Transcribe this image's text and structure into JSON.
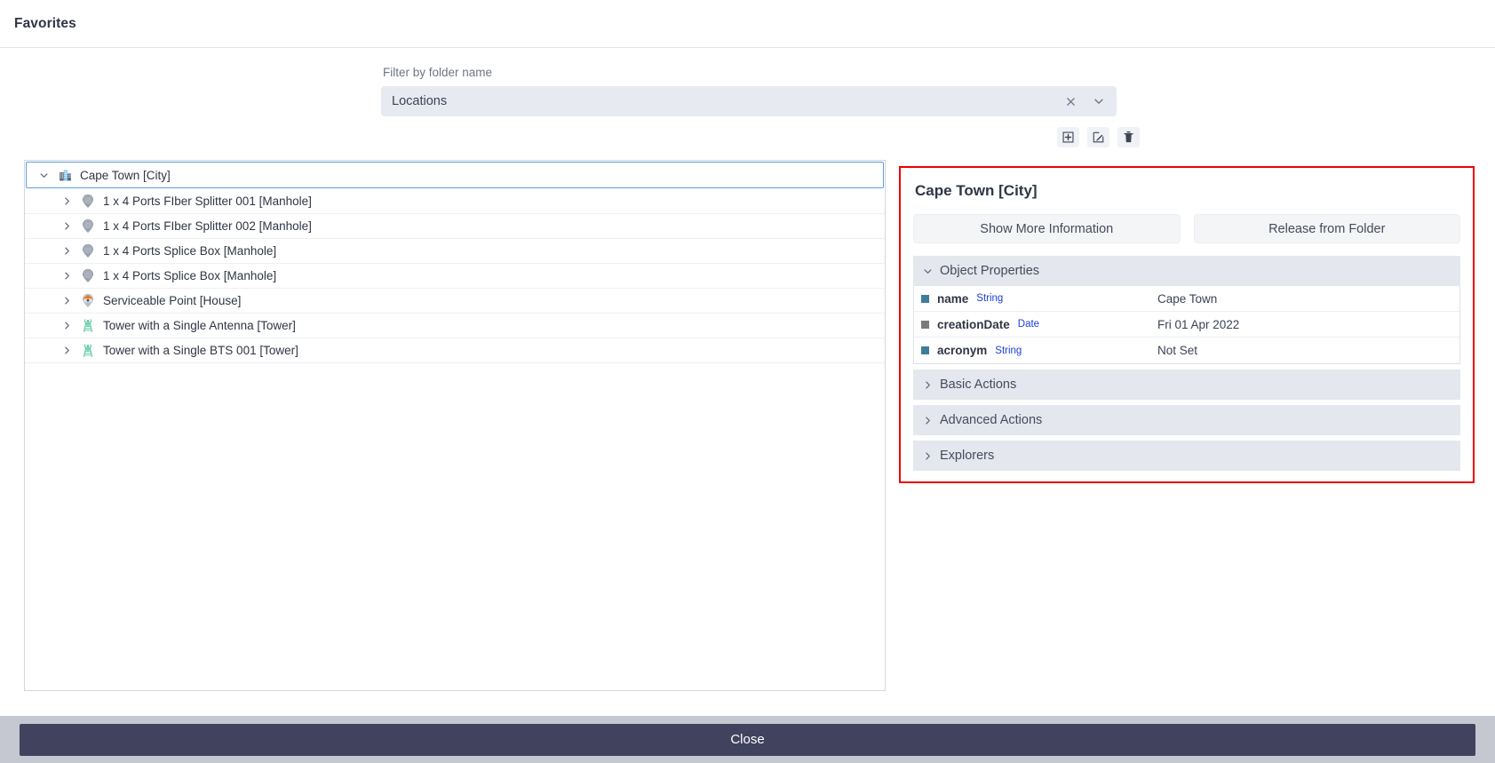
{
  "header": {
    "title": "Favorites"
  },
  "filter": {
    "label": "Filter by folder name",
    "value": "Locations",
    "placeholder": "Filter by folder name",
    "clear_icon": "close-icon",
    "dropdown_icon": "chevron-down-icon"
  },
  "toolbar": {
    "add_label": "Add Folder",
    "edit_label": "Edit Folder",
    "delete_label": "Delete Folder",
    "add_icon": "plus-box-icon",
    "edit_icon": "pencil-square-icon",
    "delete_icon": "trash-icon"
  },
  "tree": {
    "root": {
      "label": "Cape Town [City]",
      "icon": "city-building-icon",
      "expanded": true,
      "selected": true
    },
    "children": [
      {
        "label": "1 x 4 Ports FIber Splitter 001 [Manhole]",
        "icon": "manhole-pin-icon",
        "expanded": false
      },
      {
        "label": "1 x 4 Ports FIber Splitter 002 [Manhole]",
        "icon": "manhole-pin-icon",
        "expanded": false
      },
      {
        "label": "1 x 4 Ports Splice Box [Manhole]",
        "icon": "manhole-pin-icon",
        "expanded": false
      },
      {
        "label": "1 x 4 Ports Splice Box [Manhole]",
        "icon": "manhole-pin-icon",
        "expanded": false
      },
      {
        "label": "Serviceable Point [House]",
        "icon": "house-pin-icon",
        "expanded": false
      },
      {
        "label": "Tower with a Single Antenna [Tower]",
        "icon": "tower-icon",
        "expanded": false
      },
      {
        "label": "Tower with a Single BTS 001 [Tower]",
        "icon": "tower-icon",
        "expanded": false
      }
    ]
  },
  "detail": {
    "title": "Cape Town [City]",
    "buttons": {
      "show_more": "Show More Information",
      "release": "Release from Folder"
    },
    "sections": {
      "object_properties": "Object Properties",
      "basic_actions": "Basic Actions",
      "advanced_actions": "Advanced Actions",
      "explorers": "Explorers"
    },
    "properties": [
      {
        "name": "name",
        "type": "String",
        "value": "Cape Town",
        "swatch": "#3f7d9c"
      },
      {
        "name": "creationDate",
        "type": "Date",
        "value": "Fri 01 Apr 2022",
        "swatch": "#7b7b7b"
      },
      {
        "name": "acronym",
        "type": "String",
        "value": "Not Set",
        "swatch": "#3f7d9c"
      }
    ],
    "highlight_color": "#ee0000"
  },
  "footer": {
    "close_label": "Close"
  }
}
